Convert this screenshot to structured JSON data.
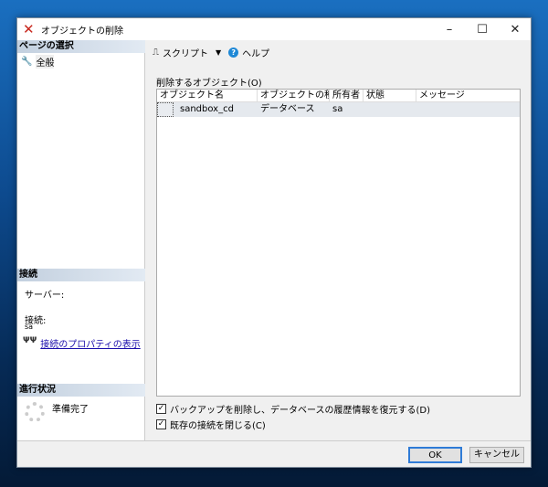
{
  "window": {
    "title": "オブジェクトの削除",
    "minimize": "–",
    "maximize": "☐",
    "close": "✕"
  },
  "left": {
    "page_select_header": "ページの選択",
    "pages": [
      {
        "label": "全般"
      }
    ],
    "connection_header": "接続",
    "server_label": "サーバー:",
    "server_value": "",
    "connection_label": "接続:",
    "connection_value": "sa",
    "view_props_link": "接続のプロパティの表示",
    "progress_header": "進行状況",
    "progress_status": "準備完了"
  },
  "toolbar": {
    "script_label": "スクリプト",
    "help_label": "ヘルプ"
  },
  "objects": {
    "label": "削除するオブジェクト(O)",
    "columns": [
      "オブジェクト名",
      "オブジェクトの種類",
      "所有者",
      "状態",
      "メッセージ"
    ],
    "rows": [
      {
        "name": "sandbox_cd",
        "type": "データベース",
        "owner": "sa",
        "status": "",
        "message": ""
      }
    ]
  },
  "options": [
    {
      "label": "バックアップを削除し、データベースの履歴情報を復元する(D)",
      "checked": true
    },
    {
      "label": "既存の接続を閉じる(C)",
      "checked": true
    }
  ],
  "buttons": {
    "ok": "OK",
    "cancel": "キャンセル"
  }
}
